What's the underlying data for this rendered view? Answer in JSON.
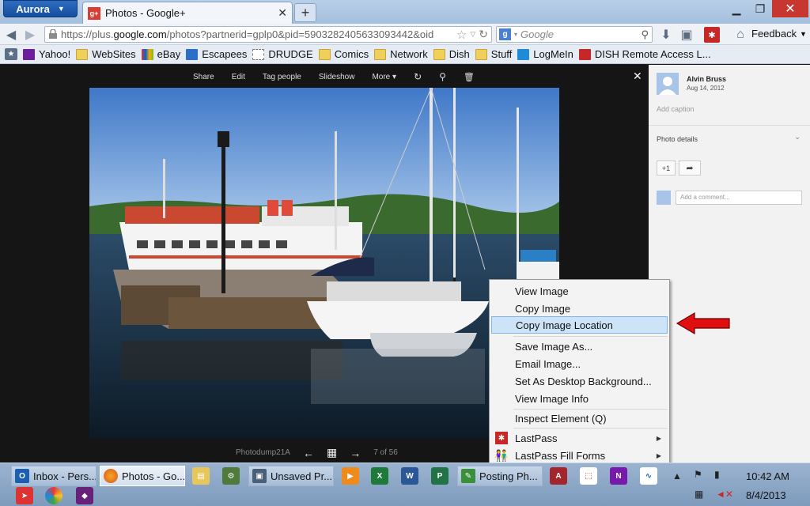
{
  "browser": {
    "app_button": "Aurora",
    "tab": {
      "title": "Photos - Google+",
      "favicon": "g+"
    },
    "url": {
      "prefix": "https://plus.",
      "domain": "google.com",
      "rest": "/photos?partnerid=gplp0&pid=5903282405633093442&oid"
    },
    "search_placeholder": "Google",
    "feedback_label": "Feedback",
    "bookmarks": [
      {
        "label": "Yahoo!",
        "icon": "yahoo-icon",
        "color": "#6b1f9c"
      },
      {
        "label": "WebSites",
        "icon": "folder-icon"
      },
      {
        "label": "eBay",
        "icon": "ebay-icon",
        "color": "#e53238"
      },
      {
        "label": "Escapees",
        "icon": "escapees-icon",
        "color": "#2c6fc9"
      },
      {
        "label": "DRUDGE",
        "icon": "page-icon"
      },
      {
        "label": "Comics",
        "icon": "folder-icon"
      },
      {
        "label": "Network",
        "icon": "folder-icon"
      },
      {
        "label": "Dish",
        "icon": "folder-icon"
      },
      {
        "label": "Stuff",
        "icon": "folder-icon"
      },
      {
        "label": "LogMeIn",
        "icon": "logmein-icon",
        "color": "#1f8bd6"
      },
      {
        "label": "DISH Remote Access L...",
        "icon": "dish-icon",
        "color": "#c62828"
      }
    ]
  },
  "viewer": {
    "toolbar": [
      "Share",
      "Edit",
      "Tag people",
      "Slideshow",
      "More"
    ],
    "album_name": "Photodump21A",
    "position": "7 of 56"
  },
  "sidepanel": {
    "owner": "Alvin Bruss",
    "date": "Aug 14, 2012",
    "add_caption": "Add caption",
    "photo_details": "Photo details",
    "plus_one": "+1",
    "comment_placeholder": "Add a comment..."
  },
  "context_menu": {
    "items": [
      {
        "label": "View Image"
      },
      {
        "label": "Copy Image"
      },
      {
        "label": "Copy Image Location",
        "highlighted": true
      },
      {
        "label": "Save Image As..."
      },
      {
        "label": "Email Image..."
      },
      {
        "label": "Set As Desktop Background..."
      },
      {
        "label": "View Image Info"
      },
      {
        "label": "Inspect Element (Q)"
      },
      {
        "label": "LastPass",
        "submenu": true
      },
      {
        "label": "LastPass Fill Forms",
        "submenu": true
      }
    ]
  },
  "taskbar": {
    "buttons": [
      {
        "label": "Inbox - Pers...",
        "icon": "outlook-icon",
        "color": "#1a5fb4"
      },
      {
        "label": "Photos - Go...",
        "icon": "firefox-icon",
        "color": "#d9541e",
        "active": true
      },
      {
        "label": "Unsaved Pr...",
        "icon": "capture-icon",
        "color": "#4a5f7a"
      },
      {
        "label": "Posting Ph...",
        "icon": "writer-icon",
        "color": "#3a8f3a"
      }
    ],
    "clock_time": "10:42 AM",
    "clock_date": "8/4/2013"
  },
  "colors": {
    "highlight": "#cde3f7",
    "arrow": "#e01010",
    "win_close": "#c7372f"
  }
}
